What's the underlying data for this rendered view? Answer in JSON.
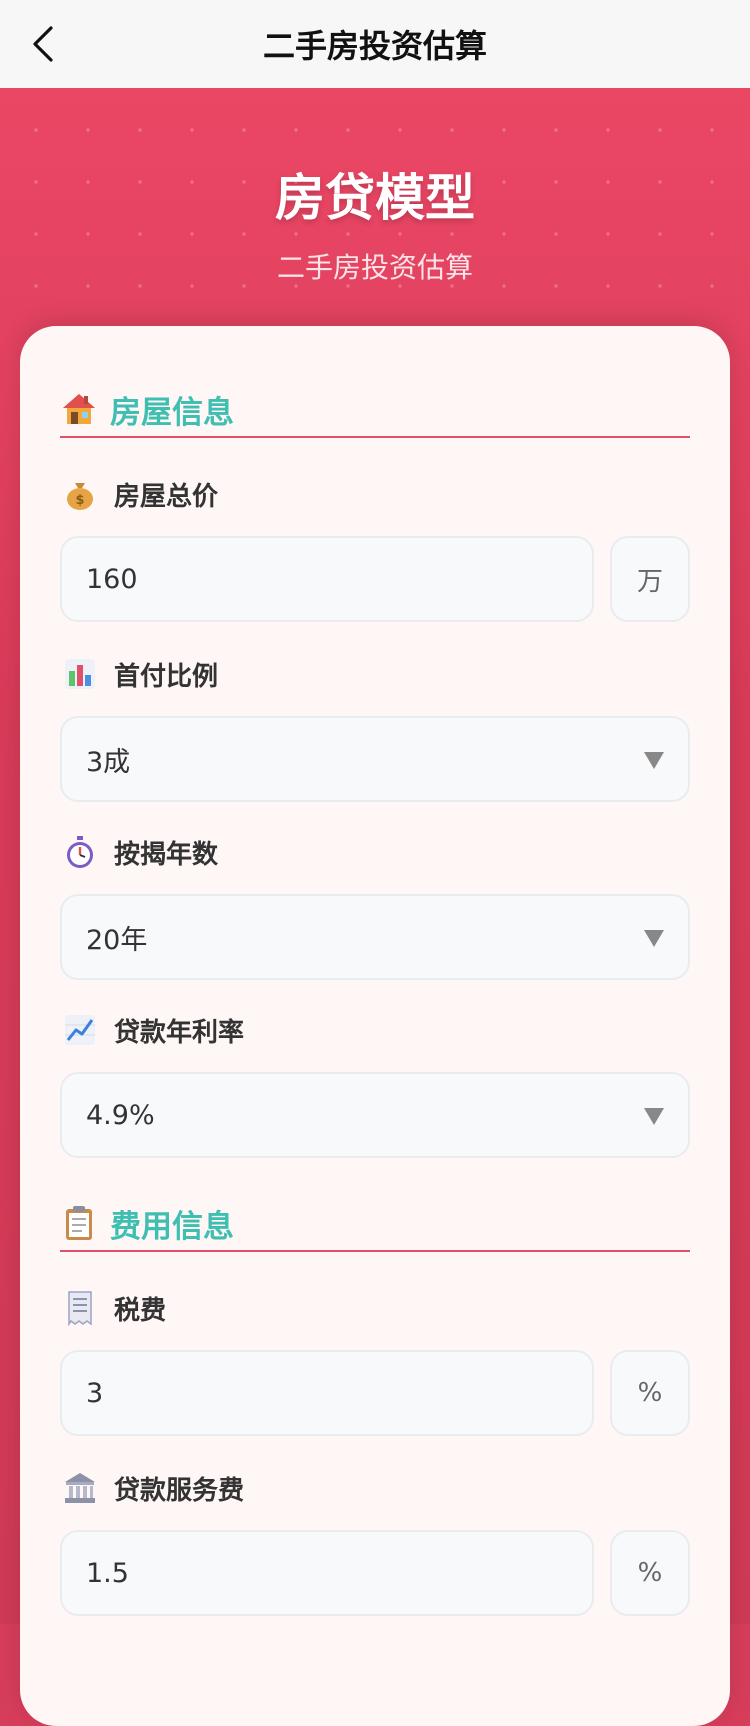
{
  "nav": {
    "title": "二手房投资估算"
  },
  "hero": {
    "title": "房贷模型",
    "subtitle": "二手房投资估算"
  },
  "sections": {
    "house": {
      "title": "房屋信息"
    },
    "fees": {
      "title": "费用信息"
    }
  },
  "fields": {
    "total_price": {
      "label": "房屋总价",
      "value": "160",
      "unit": "万"
    },
    "down_payment": {
      "label": "首付比例",
      "value": "3成"
    },
    "loan_years": {
      "label": "按揭年数",
      "value": "20年"
    },
    "interest_rate": {
      "label": "贷款年利率",
      "value": "4.9%"
    },
    "tax": {
      "label": "税费",
      "value": "3",
      "unit": "%"
    },
    "loan_service_fee": {
      "label": "贷款服务费",
      "value": "1.5",
      "unit": "%"
    }
  },
  "icons": {
    "back": "chevron-left-icon",
    "house": "house-icon",
    "money_bag": "money-bag-icon",
    "bar_chart": "bar-chart-icon",
    "stopwatch": "stopwatch-icon",
    "trend": "trend-up-icon",
    "clipboard": "clipboard-icon",
    "receipt": "receipt-icon",
    "bank": "bank-icon"
  },
  "colors": {
    "primary": "#e84663",
    "section_title": "#3fbfb1",
    "card_bg": "#fff6f6"
  }
}
